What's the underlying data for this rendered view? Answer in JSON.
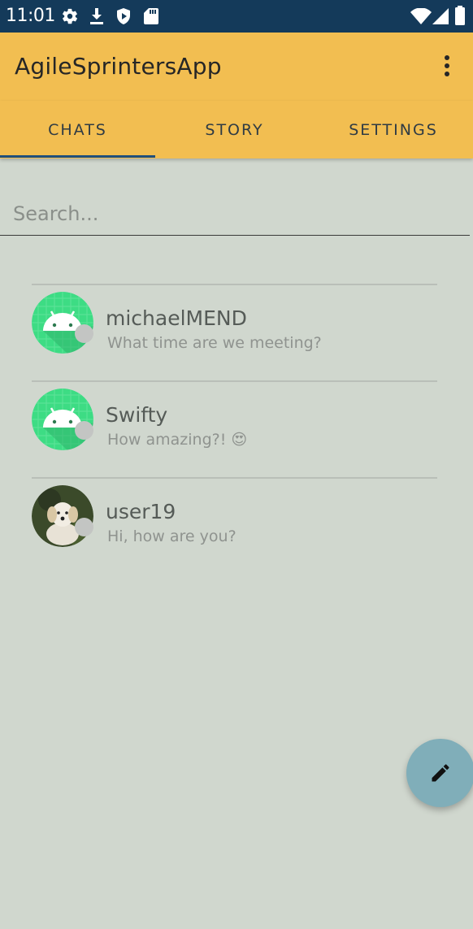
{
  "status_bar": {
    "time": "11:01",
    "icons": [
      "gear-icon",
      "download-icon",
      "shield-icon",
      "sd-card-icon",
      "wifi-icon",
      "signal-icon",
      "battery-icon"
    ]
  },
  "app_bar": {
    "title": "AgileSprintersApp",
    "menu_icon": "overflow-menu-icon"
  },
  "tabs": [
    {
      "label": "CHATS",
      "active": true
    },
    {
      "label": "STORY",
      "active": false
    },
    {
      "label": "SETTINGS",
      "active": false
    }
  ],
  "search": {
    "placeholder": "Search...",
    "value": ""
  },
  "chats": [
    {
      "name": "michaelMEND",
      "message": "What time are we meeting?",
      "avatar": "android-avatar"
    },
    {
      "name": "Swifty",
      "message": "How amazing?! 😍",
      "avatar": "android-avatar"
    },
    {
      "name": "user19",
      "message": "Hi, how are you?",
      "avatar": "dog-photo-avatar"
    }
  ],
  "fab": {
    "icon": "pencil-icon"
  },
  "colors": {
    "status_bar": "#143a5a",
    "app_bar": "#f2be51",
    "background": "#d0d7ce",
    "tab_indicator": "#1f4f7c",
    "fab": "#80aeb9",
    "avatar_green": "#3ddc84"
  }
}
